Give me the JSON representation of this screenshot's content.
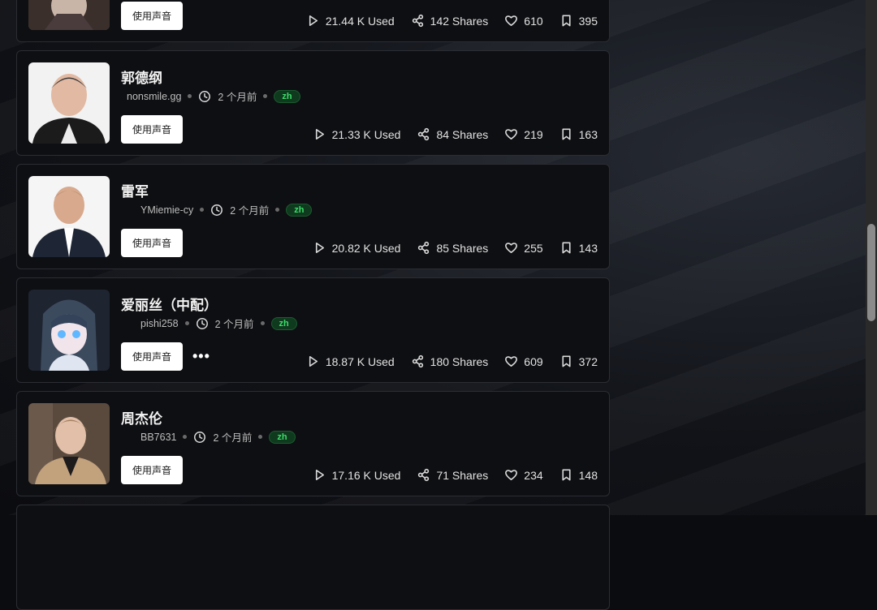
{
  "use_voice_label": "使用声音",
  "more_label": "•••",
  "cards": [
    {
      "title": "",
      "author": "",
      "time": "",
      "lang": "",
      "used": "21.44 K Used",
      "shares": "142 Shares",
      "likes": "610",
      "saves": "395"
    },
    {
      "title": "郭德纲",
      "author": "nonsmile.gg",
      "time": "2 个月前",
      "lang": "zh",
      "used": "21.33 K Used",
      "shares": "84 Shares",
      "likes": "219",
      "saves": "163"
    },
    {
      "title": "雷军",
      "author": "YMiemie-cy",
      "time": "2 个月前",
      "lang": "zh",
      "used": "20.82 K Used",
      "shares": "85 Shares",
      "likes": "255",
      "saves": "143"
    },
    {
      "title": "爱丽丝（中配）",
      "author": "pishi258",
      "time": "2 个月前",
      "lang": "zh",
      "used": "18.87 K Used",
      "shares": "180 Shares",
      "likes": "609",
      "saves": "372"
    },
    {
      "title": "周杰伦",
      "author": "BB7631",
      "time": "2 个月前",
      "lang": "zh",
      "used": "17.16 K Used",
      "shares": "71 Shares",
      "likes": "234",
      "saves": "148"
    }
  ]
}
